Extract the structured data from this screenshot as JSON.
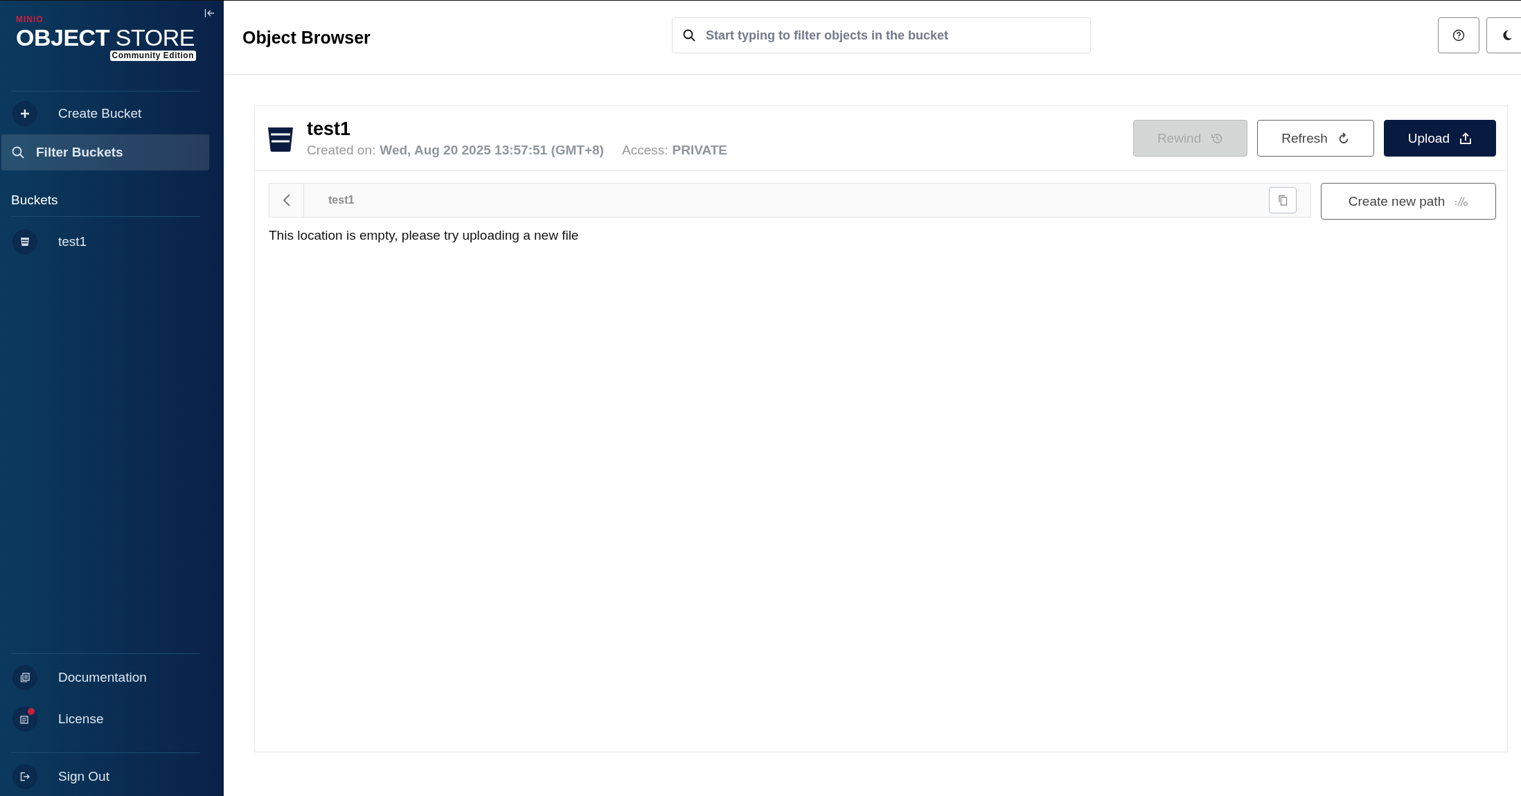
{
  "sidebar": {
    "logo": {
      "brand": "MINIO",
      "product": "**OBJECT** STORE",
      "edition": "Community Edition"
    },
    "actions": [
      {
        "label": "Create Bucket",
        "kind": "create",
        "selected": false
      },
      {
        "label": "Filter Buckets",
        "kind": "filter",
        "selected": true
      }
    ],
    "section_title": "Buckets",
    "buckets": [
      {
        "name": "test1"
      }
    ],
    "footer_items": [
      {
        "label": "Documentation",
        "kind": "docs",
        "notification": false
      },
      {
        "label": "License",
        "kind": "license",
        "notification": true
      },
      {
        "label": "Sign Out",
        "kind": "signout",
        "notification": false
      }
    ]
  },
  "header": {
    "title": "Object Browser",
    "search": {
      "placeholder": "Start typing to filter objects in the bucket"
    }
  },
  "bucket": {
    "name": "test1",
    "created_label": "Created on:",
    "created_value": "Wed, Aug 20 2025 13:57:51 (GMT+8)",
    "access_label": "Access:",
    "access_value": "PRIVATE",
    "buttons": [
      {
        "label": "Rewind",
        "kind": "rewind",
        "disabled": true
      },
      {
        "label": "Refresh",
        "kind": "refresh",
        "disabled": false
      },
      {
        "label": "Upload",
        "kind": "upload",
        "disabled": false
      }
    ]
  },
  "browser": {
    "path": "test1",
    "create_path_label": "Create new path",
    "empty_message": "This location is empty, please try uploading a new file"
  }
}
